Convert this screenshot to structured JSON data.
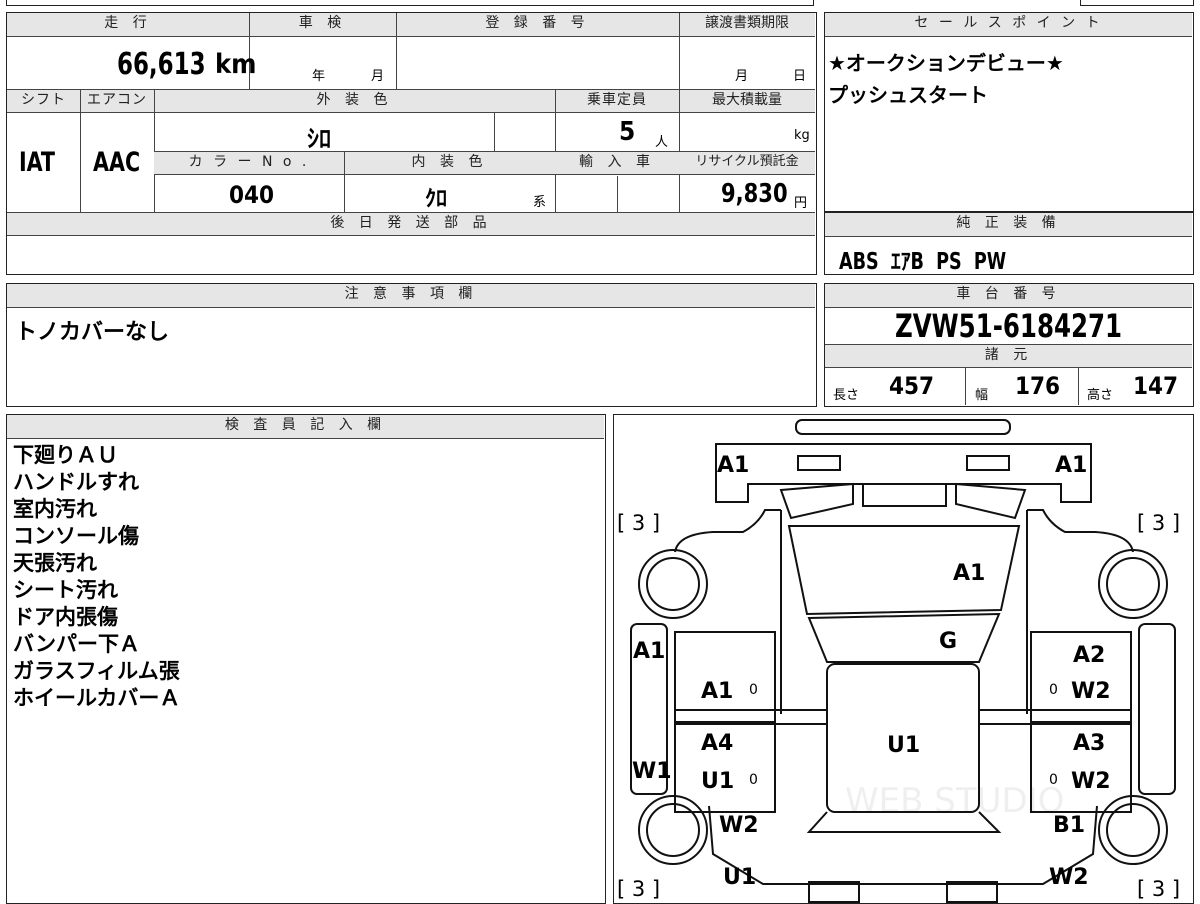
{
  "labels": {
    "mileage": "走 行",
    "inspection": "車 検",
    "registration": "登 録 番 号",
    "transfer_deadline": "譲渡書類期限",
    "sales_point": "セ ー ル ス ポ イ ン ト",
    "shift": "シフト",
    "aircon": "エアコン",
    "exterior_color": "外 装 色",
    "capacity": "乗車定員",
    "max_load": "最大積載量",
    "color_no": "カ ラ ー N o .",
    "interior_color": "内 装 色",
    "import": "輸 入 車",
    "recycle": "リサイクル預託金",
    "later_parts": "後 日 発 送 部 品",
    "factory_equipment": "純 正 装 備",
    "notes": "注 意 事 項 欄",
    "chassis_no": "車 台 番 号",
    "specs": "諸 元",
    "inspector": "検 査 員 記 入 欄"
  },
  "units": {
    "year": "年",
    "month": "月",
    "day": "日",
    "person": "人",
    "kg": "kg",
    "yen": "円",
    "kei": "系"
  },
  "values": {
    "mileage": "66,613",
    "mileage_unit": "km",
    "shift": "IAT",
    "aircon": "AAC",
    "exterior_color": "ｼﾛ",
    "capacity": "5",
    "color_no": "040",
    "interior_color": "ｸﾛ",
    "recycle_fee": "9,830",
    "sales_point_lines": [
      "★オークションデビュー★",
      "プッシュスタート"
    ],
    "factory_equipment": "ABS  ｴｱB  PS  PW",
    "notes": "トノカバーなし",
    "chassis_no": "ZVW51-6184271",
    "length_label": "長さ",
    "length": "457",
    "width_label": "幅",
    "width": "176",
    "height_label": "高さ",
    "height": "147"
  },
  "inspector_notes": [
    "下廻りＡＵ",
    "ハンドルすれ",
    "室内汚れ",
    "コンソール傷",
    "天張汚れ",
    "シート汚れ",
    "ドア内張傷",
    "バンパー下Ａ",
    "ガラスフィルム張",
    "ホイールカバーＡ"
  ],
  "diagram": {
    "front_left": "A1",
    "front_right": "A1",
    "tire_fl": "[ 3 ]",
    "tire_fr": "[ 3 ]",
    "tire_rl": "[ 3 ]",
    "tire_rr": "[ 3 ]",
    "hood": "A1",
    "windshield": "G",
    "fender_left": "A1",
    "door_fl": "A1",
    "door_fl_n": "0",
    "fender_right": "A2",
    "door_fr": "W2",
    "door_fr_n": "0",
    "door_rl_top": "A4",
    "door_rl": "U1",
    "door_rl_n": "0",
    "door_rr_top": "A3",
    "door_rr": "W2",
    "door_rr_n": "0",
    "roof": "U1",
    "sill_left": "W1",
    "quarter_left": "W2",
    "quarter_right": "B1",
    "rear_left": "U1",
    "rear_right": "W2",
    "watermark": "WEB STUDIO"
  }
}
